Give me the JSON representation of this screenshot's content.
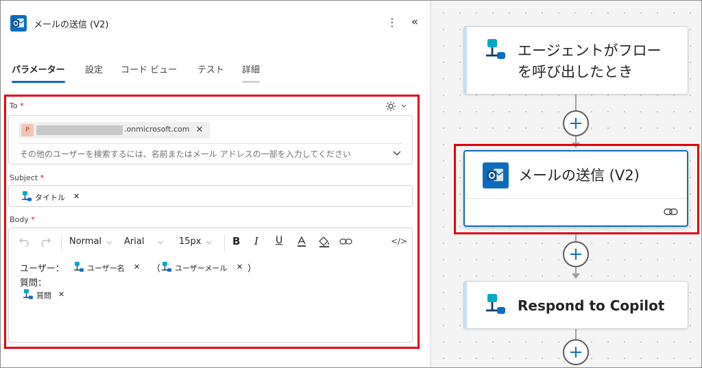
{
  "panel": {
    "title": "メールの送信 (V2)",
    "more_icon": "kebab-icon",
    "collapse_icon": "double-chevron-left-icon",
    "tabs": [
      {
        "label": "パラメーター",
        "active": true
      },
      {
        "label": "設定"
      },
      {
        "label": "コード ビュー"
      },
      {
        "label": "テスト"
      },
      {
        "label": "詳細"
      }
    ]
  },
  "to_field": {
    "label": "To",
    "required_mark": "*",
    "recipient_initial": "P",
    "recipient_domain": ".onmicrosoft.com",
    "remove_glyph": "✕",
    "placeholder": "その他のユーザーを検索するには、名前またはメール アドレスの一部を入力してください"
  },
  "subject_field": {
    "label": "Subject",
    "required_mark": "*",
    "token": "タイトル",
    "remove_glyph": "✕"
  },
  "body_field": {
    "label": "Body",
    "required_mark": "*",
    "toolbar": {
      "format": "Normal",
      "font": "Arial",
      "size": "15px",
      "bold": "B",
      "italic": "I",
      "underline": "U",
      "code_view": "</>"
    },
    "line1_prefix": "ユーザー：",
    "token_user_name": "ユーザー名",
    "open_paren": "（",
    "token_user_email": "ユーザーメール",
    "close_paren": "）",
    "line2": "質問：",
    "token_question": "質問",
    "remove_glyph": "✕"
  },
  "flow": {
    "trigger_line1": "エージェントがフロー",
    "trigger_line2": "を呼び出したとき",
    "action_title": "メールの送信 (V2)",
    "respond_title": "Respond to Copilot",
    "accent_color": "#0f6cbd",
    "highlight_color": "#e0000b"
  }
}
